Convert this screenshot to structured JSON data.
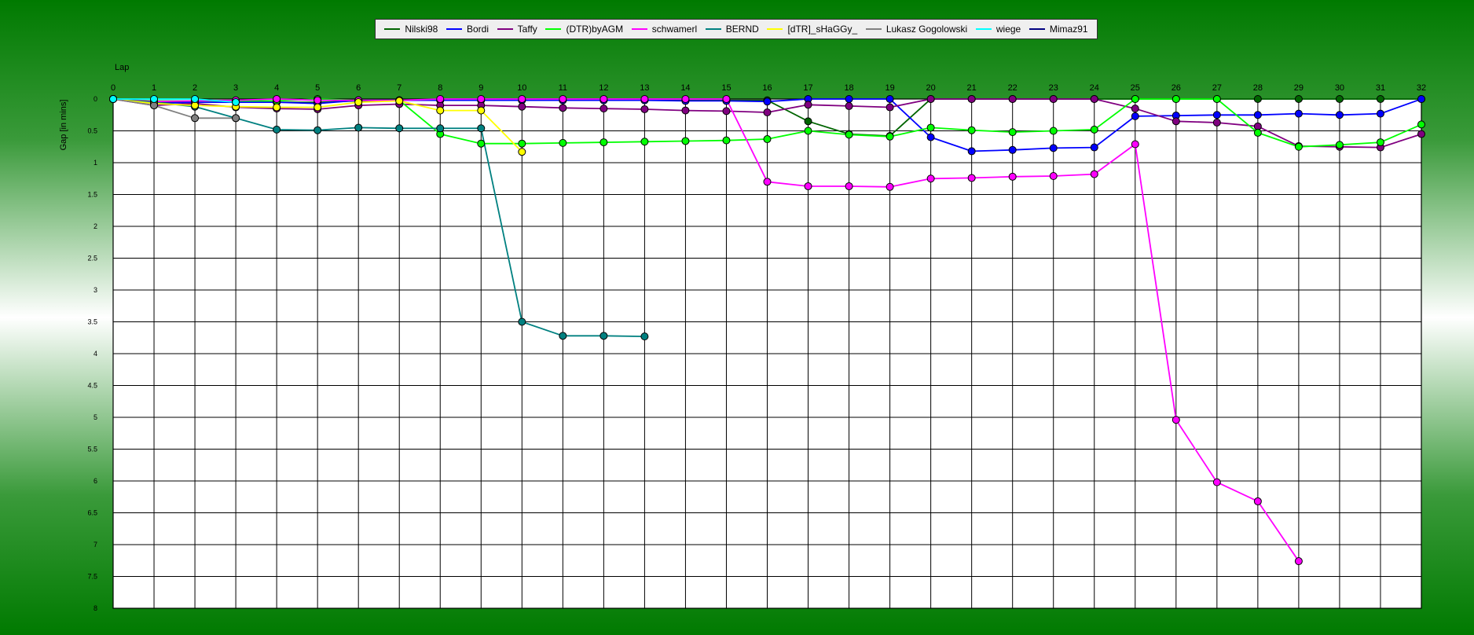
{
  "chart_data": {
    "type": "line",
    "title": "",
    "xlabel": "Lap",
    "ylabel": "Gap [in mins]",
    "xlim": [
      0,
      32
    ],
    "ylim": [
      0,
      8
    ],
    "y_inverted": true,
    "x_ticks": [
      0,
      1,
      2,
      3,
      4,
      5,
      6,
      7,
      8,
      9,
      10,
      11,
      12,
      13,
      14,
      15,
      16,
      17,
      18,
      19,
      20,
      21,
      22,
      23,
      24,
      25,
      26,
      27,
      28,
      29,
      30,
      31,
      32
    ],
    "y_ticks": [
      {
        "value": 0,
        "label": "0"
      },
      {
        "value": 0.5,
        "label": "0.5"
      },
      {
        "value": 1,
        "label": "1"
      },
      {
        "value": 1.5,
        "label": "1.5"
      },
      {
        "value": 2,
        "label": "2"
      },
      {
        "value": 2.5,
        "label": "2.5"
      },
      {
        "value": 3,
        "label": "3"
      },
      {
        "value": 3.5,
        "label": "3.5"
      },
      {
        "value": 4,
        "label": "4"
      },
      {
        "value": 4.5,
        "label": "4.5"
      },
      {
        "value": 5,
        "label": "5"
      },
      {
        "value": 5.5,
        "label": "5.5"
      },
      {
        "value": 6,
        "label": "6"
      },
      {
        "value": 6.5,
        "label": "6.5"
      },
      {
        "value": 7,
        "label": "7"
      },
      {
        "value": 7.5,
        "label": "7.5"
      },
      {
        "value": 8,
        "label": "8"
      }
    ],
    "grid": true,
    "legend_position": "top",
    "series": [
      {
        "name": "Nilski98",
        "color": "#006400",
        "x": [
          0,
          1,
          2,
          3,
          4,
          5,
          6,
          7,
          8,
          9,
          10,
          11,
          12,
          13,
          14,
          15,
          16,
          17,
          18,
          19,
          20,
          21,
          22,
          23,
          24,
          25,
          26,
          27,
          28,
          29,
          30,
          31,
          32
        ],
        "y": [
          0,
          0.05,
          0.05,
          0.05,
          0.05,
          0.05,
          0.03,
          0.02,
          0.02,
          0.02,
          0.02,
          0.02,
          0.02,
          0.02,
          0.02,
          0.02,
          0.02,
          0.35,
          0.55,
          0.58,
          0,
          0,
          0,
          0,
          0,
          0,
          0,
          0,
          0,
          0,
          0,
          0,
          0
        ]
      },
      {
        "name": "Bordi",
        "color": "#0000ff",
        "x": [
          0,
          1,
          2,
          3,
          4,
          5,
          6,
          7,
          8,
          9,
          10,
          11,
          12,
          13,
          14,
          15,
          16,
          17,
          18,
          19,
          20,
          21,
          22,
          23,
          24,
          25,
          26,
          27,
          28,
          29,
          30,
          31,
          32
        ],
        "y": [
          0,
          0.07,
          0.05,
          0.05,
          0.05,
          0.07,
          0.02,
          0.02,
          0.02,
          0.02,
          0.02,
          0.02,
          0.02,
          0.02,
          0.03,
          0.03,
          0.04,
          0,
          0,
          0,
          0.6,
          0.82,
          0.8,
          0.77,
          0.76,
          0.27,
          0.26,
          0.25,
          0.25,
          0.23,
          0.25,
          0.23,
          0
        ]
      },
      {
        "name": "Taffy",
        "color": "#800080",
        "x": [
          0,
          1,
          2,
          3,
          4,
          5,
          6,
          7,
          8,
          9,
          10,
          11,
          12,
          13,
          14,
          15,
          16,
          17,
          18,
          19,
          20,
          21,
          22,
          23,
          24,
          25,
          26,
          27,
          28,
          29,
          30,
          31,
          32
        ],
        "y": [
          0,
          0.1,
          0.07,
          0.13,
          0.15,
          0.16,
          0.1,
          0.08,
          0.1,
          0.1,
          0.12,
          0.14,
          0.15,
          0.16,
          0.18,
          0.19,
          0.21,
          0.09,
          0.11,
          0.13,
          0,
          0,
          0,
          0,
          0,
          0.15,
          0.35,
          0.37,
          0.43,
          0.74,
          0.75,
          0.76,
          0.55
        ]
      },
      {
        "name": "(DTR)byAGM",
        "color": "#00ff00",
        "x": [
          0,
          1,
          2,
          3,
          4,
          5,
          6,
          7,
          8,
          9,
          10,
          11,
          12,
          13,
          14,
          15,
          16,
          17,
          18,
          19,
          20,
          21,
          22,
          23,
          24,
          25,
          26,
          27,
          28,
          29,
          30,
          31,
          32
        ],
        "y": [
          0,
          0.03,
          0.03,
          0.03,
          0.03,
          0,
          0.02,
          0.02,
          0.55,
          0.7,
          0.7,
          0.69,
          0.68,
          0.67,
          0.66,
          0.65,
          0.63,
          0.5,
          0.56,
          0.59,
          0.45,
          0.49,
          0.52,
          0.5,
          0.48,
          0,
          0,
          0,
          0.53,
          0.75,
          0.72,
          0.68,
          0.4
        ]
      },
      {
        "name": "schwamerl",
        "color": "#ff00ff",
        "x": [
          0,
          1,
          2,
          3,
          4,
          5,
          6,
          7,
          8,
          9,
          10,
          11,
          12,
          13,
          14,
          15,
          16,
          17,
          18,
          19,
          20,
          21,
          22,
          23,
          24,
          25,
          26,
          27,
          28,
          29
        ],
        "y": [
          0,
          0.04,
          0.03,
          0.02,
          0,
          0.02,
          0.02,
          0.02,
          0,
          0,
          0,
          0,
          0,
          0,
          0,
          0,
          1.3,
          1.37,
          1.37,
          1.38,
          1.25,
          1.24,
          1.22,
          1.21,
          1.18,
          0.71,
          5.04,
          6.02,
          6.32,
          7.26
        ]
      },
      {
        "name": "BERND",
        "color": "#008080",
        "x": [
          0,
          1,
          2,
          3,
          4,
          5,
          6,
          7,
          8,
          9,
          10,
          11,
          12,
          13
        ],
        "y": [
          0,
          0.05,
          0.12,
          0.3,
          0.48,
          0.49,
          0.45,
          0.46,
          0.46,
          0.46,
          3.5,
          3.72,
          3.72,
          3.73
        ]
      },
      {
        "name": "[dTR]_sHaGGy_",
        "color": "#ffff00",
        "x": [
          0,
          1,
          2,
          3,
          4,
          5,
          6,
          7,
          8,
          9,
          10
        ],
        "y": [
          0,
          0.07,
          0.1,
          0.12,
          0.13,
          0.13,
          0.05,
          0.03,
          0.18,
          0.18,
          0.83
        ]
      },
      {
        "name": "Lukasz Gogolowski",
        "color": "#808080",
        "x": [
          0,
          1,
          2,
          3
        ],
        "y": [
          0,
          0.1,
          0.3,
          0.3
        ]
      },
      {
        "name": "wiege",
        "color": "#00ffff",
        "x": [
          0,
          1,
          2,
          3
        ],
        "y": [
          0,
          0,
          0,
          0.05
        ]
      },
      {
        "name": "Mimaz91",
        "color": "#000080",
        "x": [],
        "y": []
      }
    ]
  }
}
